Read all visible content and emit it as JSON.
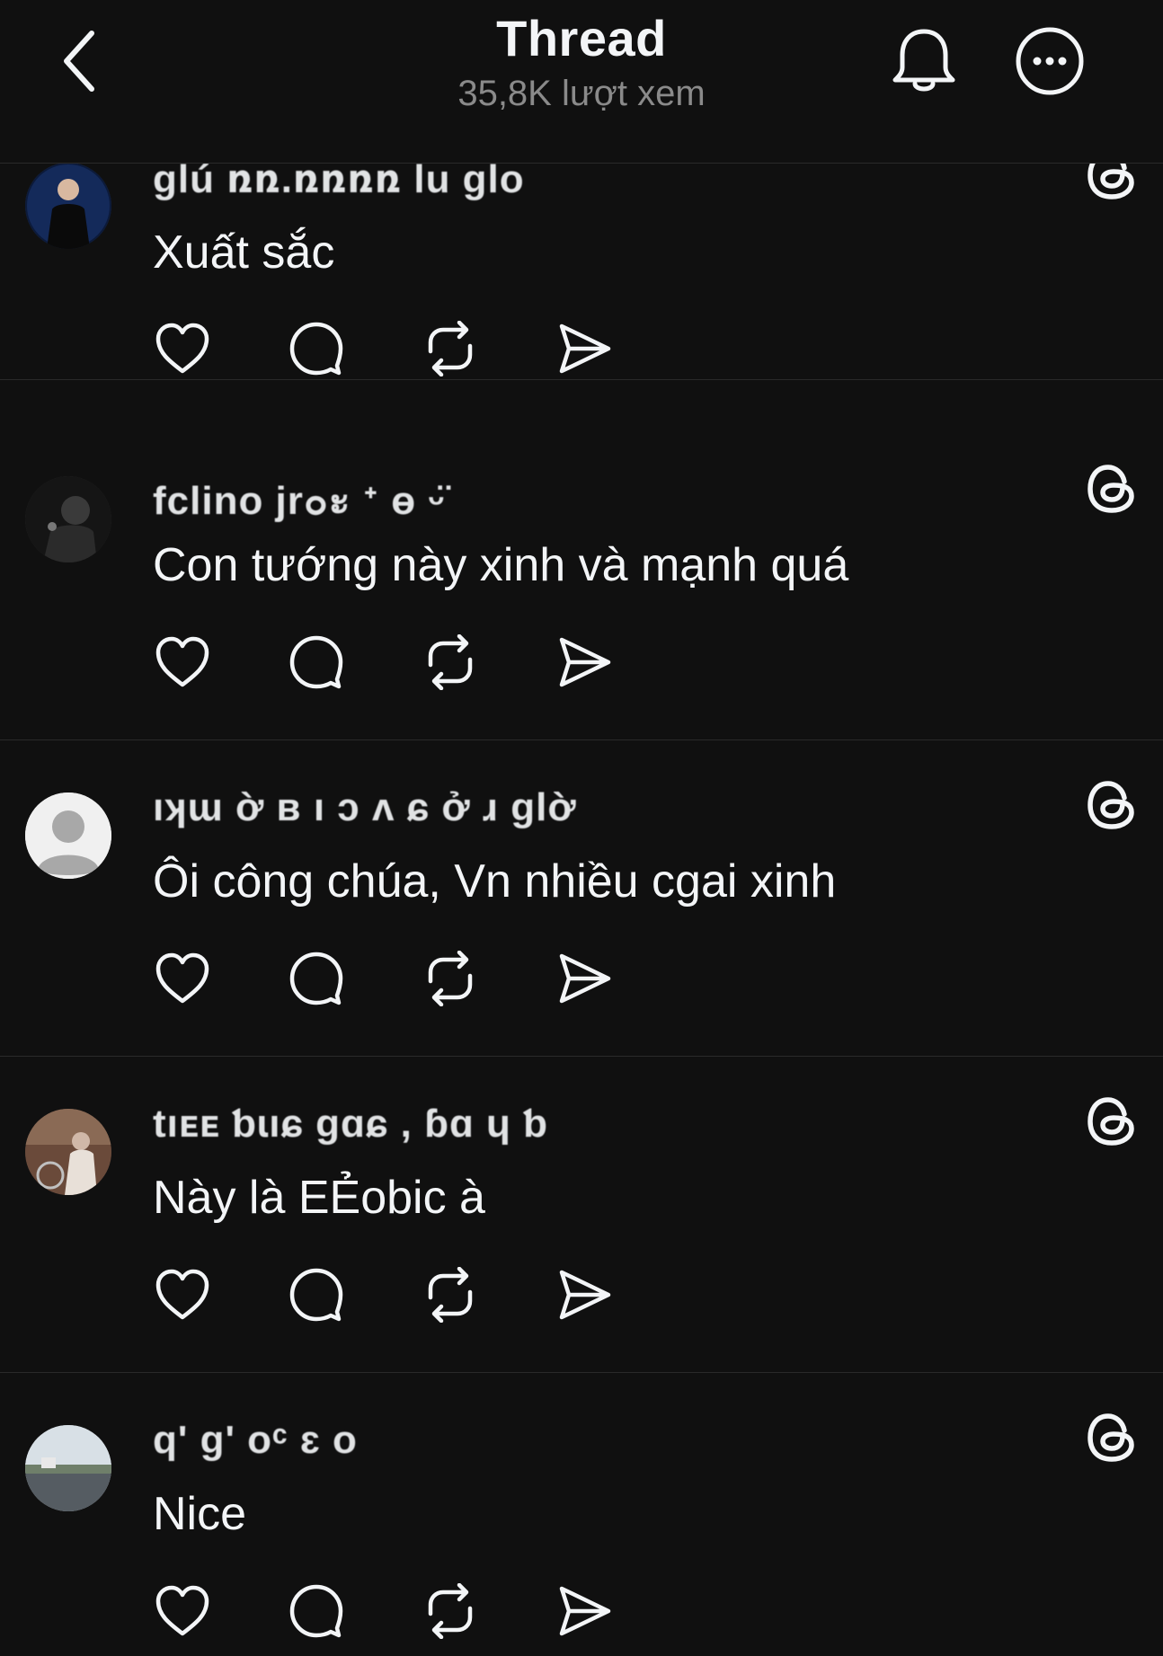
{
  "header": {
    "title": "Thread",
    "views": "35,8K lượt xem"
  },
  "posts": [
    {
      "username": "ɡlú ռռ.ռռռռ lu ɡlo",
      "text": "Xuất sắc",
      "avatar": "profile-photo-dark-blue"
    },
    {
      "username": "fclino jr๐ะ  ᐩ ɵ ᵕ̈",
      "text": "Con tướng này xinh và mạnh quá",
      "avatar": "profile-photo-smoking"
    },
    {
      "username": "ıʞɯ ờ  ʙ  ı ɔ  ʌ  ɕ ở  ɹ  ɡlờ",
      "text": "Ôi công chúa, Vn nhiều cgai xinh",
      "avatar": "default-avatar"
    },
    {
      "username": "tıᴇᴇ  ƅɩıɕ ɡɑɕ , ɓɑ ɥ  ƅ",
      "text": "Này là EẺobic à",
      "avatar": "profile-photo-outdoor"
    },
    {
      "username": "q'   ɡ'   oᶜ   ɛ   o",
      "text": "Nice",
      "avatar": "profile-photo-road"
    }
  ],
  "icons": {
    "back": "chevron-left-icon",
    "bell": "bell-icon",
    "more": "more-circle-icon",
    "threads": "threads-logo-icon",
    "like": "heart-icon",
    "reply": "comment-icon",
    "repost": "repost-icon",
    "share": "send-icon"
  },
  "colors": {
    "background": "#101010",
    "text": "#f3f5f7",
    "secondary": "#8a8a8a",
    "divider": "#2a2a2a"
  }
}
